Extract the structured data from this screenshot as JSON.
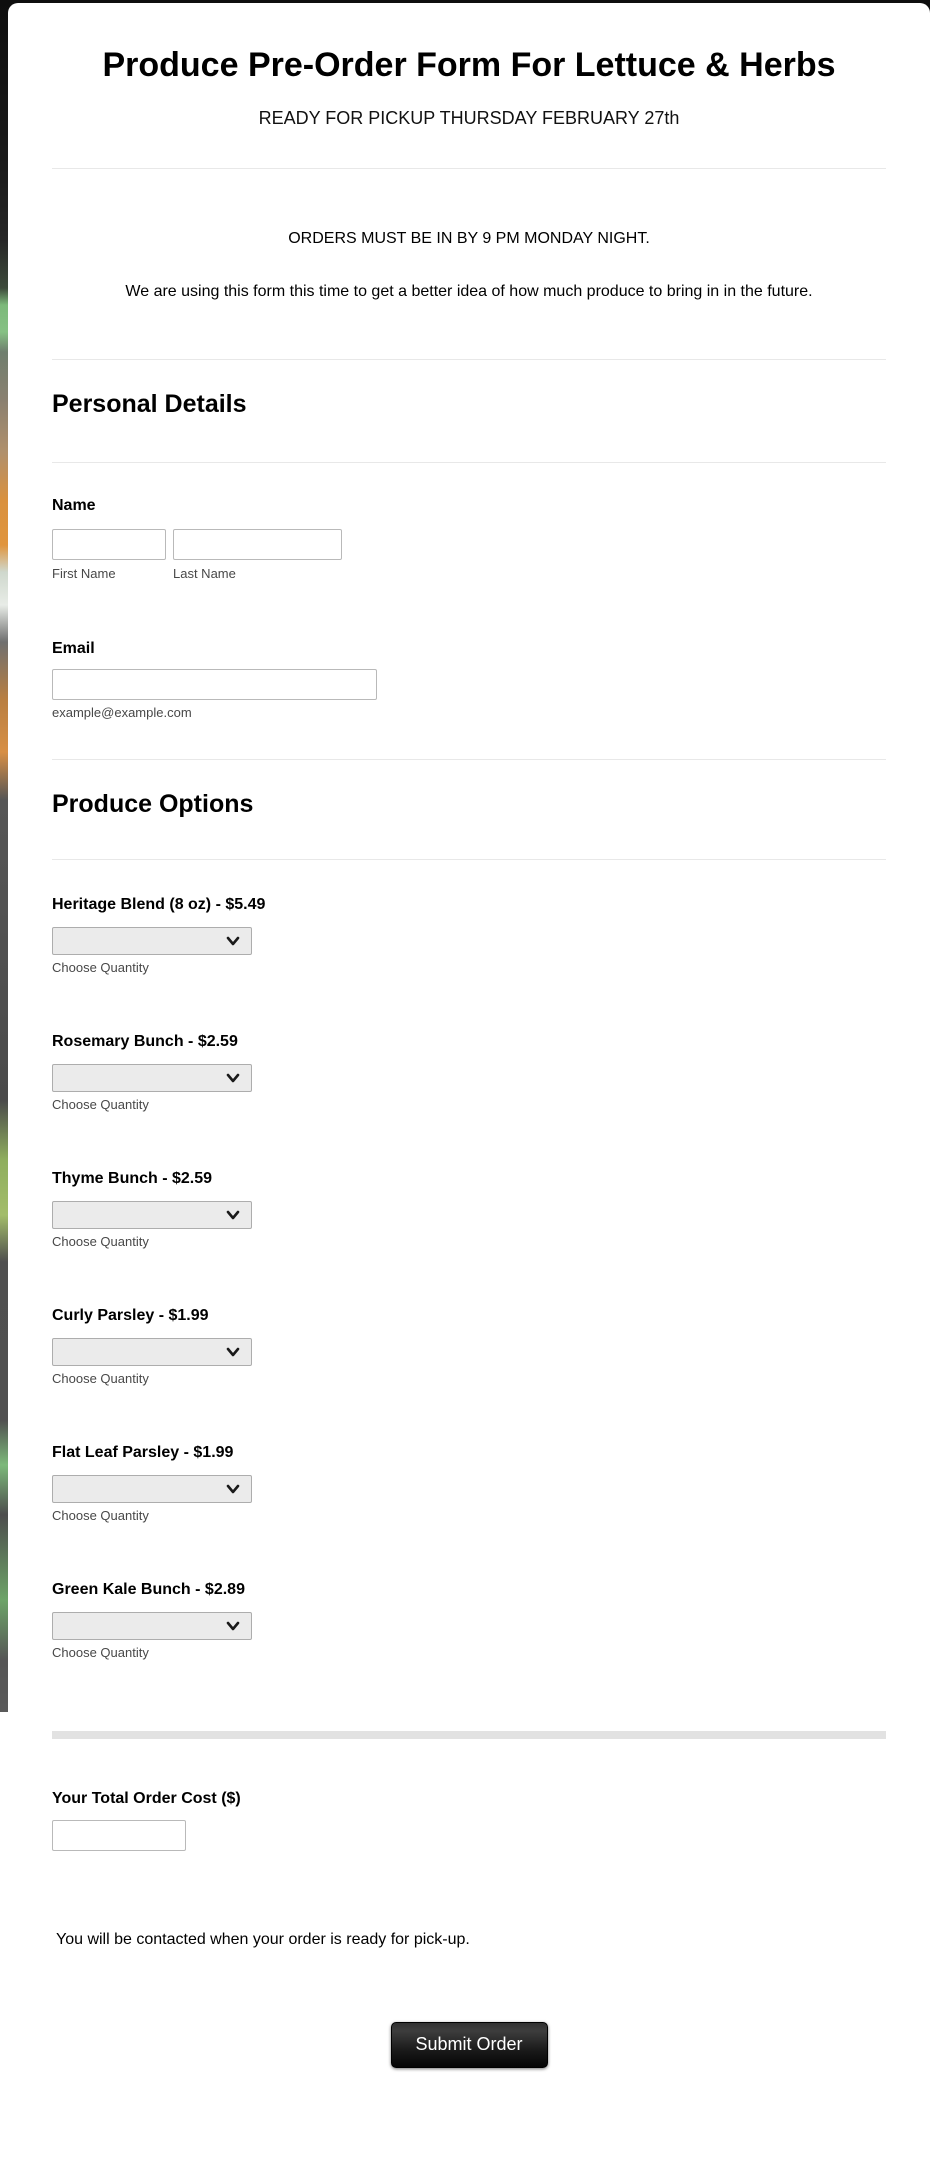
{
  "header": {
    "title": "Produce Pre-Order Form For Lettuce & Herbs",
    "subtitle": "READY FOR PICKUP THURSDAY FEBRUARY 27th"
  },
  "intro": {
    "line1": "ORDERS MUST BE IN BY 9 PM MONDAY NIGHT.",
    "line2": "We are using this form this time to get a better idea of how much produce to bring in in the future."
  },
  "personal_details": {
    "heading": "Personal Details",
    "name": {
      "label": "Name",
      "first_value": "",
      "first_sublabel": "First Name",
      "last_value": "",
      "last_sublabel": "Last Name"
    },
    "email": {
      "label": "Email",
      "value": "",
      "sublabel": "example@example.com"
    }
  },
  "produce_options": {
    "heading": "Produce Options",
    "quantity_sublabel": "Choose Quantity",
    "items": [
      {
        "label": "Heritage Blend (8 oz) - $5.49",
        "selected_value": ""
      },
      {
        "label": "Rosemary Bunch - $2.59",
        "selected_value": ""
      },
      {
        "label": "Thyme Bunch - $2.59",
        "selected_value": ""
      },
      {
        "label": "Curly Parsley - $1.99",
        "selected_value": ""
      },
      {
        "label": "Flat Leaf Parsley - $1.99",
        "selected_value": ""
      },
      {
        "label": "Green Kale Bunch - $2.89",
        "selected_value": ""
      }
    ]
  },
  "total": {
    "label": "Your Total Order Cost ($)",
    "value": ""
  },
  "footer": {
    "note": "You will be contacted when your order is ready for pick-up.",
    "submit_label": "Submit Order"
  },
  "colors": {
    "button_gradient_top": "#3d3d3d",
    "button_gradient_bottom": "#050505",
    "button_text": "#ffffff",
    "divider": "#e8e8e8",
    "thick_divider": "#e2e2e2",
    "select_background": "#ebebeb",
    "input_border": "#b9b9b9",
    "sublabel_text": "#484848",
    "background_dark": "#1c1c1c"
  }
}
